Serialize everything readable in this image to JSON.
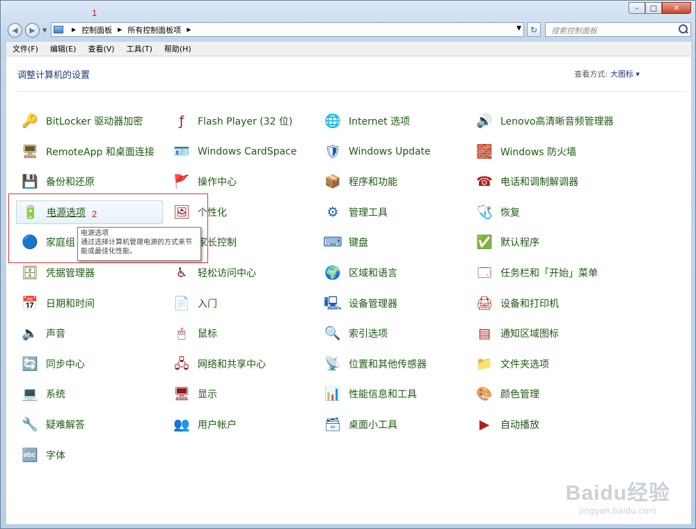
{
  "annotations": {
    "one": "1",
    "two": "2"
  },
  "window_controls": {
    "minimize": "–",
    "maximize": "□",
    "close": "✕"
  },
  "nav": {
    "back": "◀",
    "forward": "▶",
    "dropdown": "▼"
  },
  "address": {
    "crumbs": [
      "控制面板",
      "所有控制面板项"
    ],
    "sep": "▶",
    "dropdown": "▼",
    "refresh": "↻"
  },
  "search": {
    "placeholder": "搜索控制面板"
  },
  "menu": [
    "文件(F)",
    "编辑(E)",
    "查看(V)",
    "工具(T)",
    "帮助(H)"
  ],
  "page": {
    "title": "调整计算机的设置",
    "view_by_label": "查看方式:",
    "view_by_value": "大图标 ▾"
  },
  "items": [
    [
      "BitLocker 驱动器加密",
      "Flash Player (32 位)",
      "Internet 选项",
      "Lenovo高清晰音频管理器"
    ],
    [
      "RemoteApp 和桌面连接",
      "Windows CardSpace",
      "Windows Update",
      "Windows 防火墙"
    ],
    [
      "备份和还原",
      "操作中心",
      "程序和功能",
      "电话和调制解调器"
    ],
    [
      "电源选项",
      "个性化",
      "管理工具",
      "恢复"
    ],
    [
      "家庭组",
      "家长控制",
      "键盘",
      "默认程序"
    ],
    [
      "凭据管理器",
      "轻松访问中心",
      "区域和语言",
      "任务栏和「开始」菜单"
    ],
    [
      "日期和时间",
      "入门",
      "设备管理器",
      "设备和打印机"
    ],
    [
      "声音",
      "鼠标",
      "索引选项",
      "通知区域图标"
    ],
    [
      "同步中心",
      "网络和共享中心",
      "位置和其他传感器",
      "文件夹选项"
    ],
    [
      "系统",
      "显示",
      "性能信息和工具",
      "颜色管理"
    ],
    [
      "疑难解答",
      "用户帐户",
      "桌面小工具",
      "自动播放"
    ],
    [
      "字体"
    ]
  ],
  "icons": [
    [
      "🔑",
      "ƒ",
      "🌐",
      "🔊"
    ],
    [
      "🖥",
      "🪪",
      "🛡",
      "🧱"
    ],
    [
      "💾",
      "🚩",
      "📦",
      "☎"
    ],
    [
      "🔋",
      "🖼",
      "⚙",
      "🩺"
    ],
    [
      "🔵",
      "👪",
      "⌨",
      "✅"
    ],
    [
      "🗄",
      "♿",
      "🌍",
      "🗔"
    ],
    [
      "📅",
      "📄",
      "🖳",
      "🖨"
    ],
    [
      "🔈",
      "🖱",
      "🔍",
      "▤"
    ],
    [
      "🔄",
      "🖧",
      "📡",
      "📁"
    ],
    [
      "💻",
      "🖥",
      "📊",
      "🎨"
    ],
    [
      "🔧",
      "👥",
      "🗃",
      "▶"
    ],
    [
      "🔤"
    ]
  ],
  "tooltip": {
    "title": "电源选项",
    "text": "通过选择计算机管理电源的方式来节能或最佳化性能。"
  },
  "watermark": {
    "big": "Baidu经验",
    "small": "jingyan.baidu.com"
  }
}
